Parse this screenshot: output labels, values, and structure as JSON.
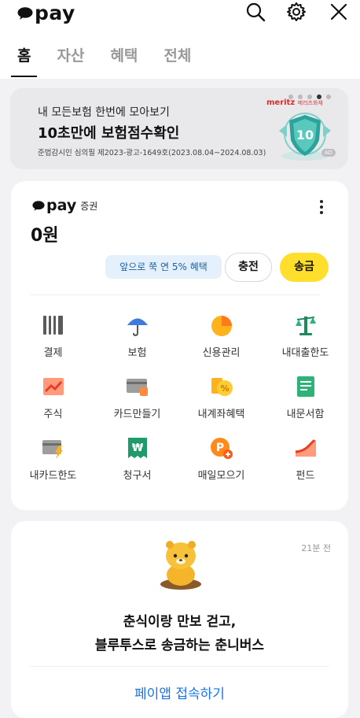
{
  "app": {
    "logo_text": "pay"
  },
  "tabs": [
    {
      "label": "홈",
      "active": true
    },
    {
      "label": "자산"
    },
    {
      "label": "혜택"
    },
    {
      "label": "전체"
    }
  ],
  "banner": {
    "line1": "내 모든보험 한번에 모아보기",
    "line2": "10초만에 보험점수확인",
    "line3": "준법감시인 심의필 제2023-광고-1649호(2023.08.04~2024.08.03)",
    "brand": "meritz",
    "brand_sub": "메리츠화재",
    "shield_text": "10",
    "ad_label": "AD",
    "page_count": 5,
    "page_active": 4
  },
  "account": {
    "brand_text": "pay",
    "sub": "증권",
    "balance": "0원",
    "promo": "앞으로 쭉 연 5% 혜택",
    "charge_label": "충전",
    "send_label": "송금"
  },
  "menu": [
    {
      "label": "결제",
      "icon": "barcode-icon"
    },
    {
      "label": "보험",
      "icon": "umbrella-icon"
    },
    {
      "label": "신용관리",
      "icon": "credit-gauge-icon"
    },
    {
      "label": "내대출한도",
      "icon": "scale-icon"
    },
    {
      "label": "주식",
      "icon": "stock-chart-icon"
    },
    {
      "label": "카드만들기",
      "icon": "card-icon"
    },
    {
      "label": "내계좌혜택",
      "icon": "percent-coin-icon"
    },
    {
      "label": "내문서함",
      "icon": "document-icon"
    },
    {
      "label": "내카드한도",
      "icon": "card-lightning-icon"
    },
    {
      "label": "청구서",
      "icon": "won-bill-icon"
    },
    {
      "label": "매일모으기",
      "icon": "point-plus-icon"
    },
    {
      "label": "펀드",
      "icon": "fund-chart-icon"
    }
  ],
  "feed": {
    "time": "21분 전",
    "line1": "춘식이랑 만보 걷고,",
    "line2": "블루투스로 송금하는 춘니버스",
    "link": "페이앱 접속하기"
  },
  "colors": {
    "brand_yellow": "#ffdf2b",
    "link_blue": "#1a73e8",
    "promo_bg": "#e4f1fc"
  }
}
